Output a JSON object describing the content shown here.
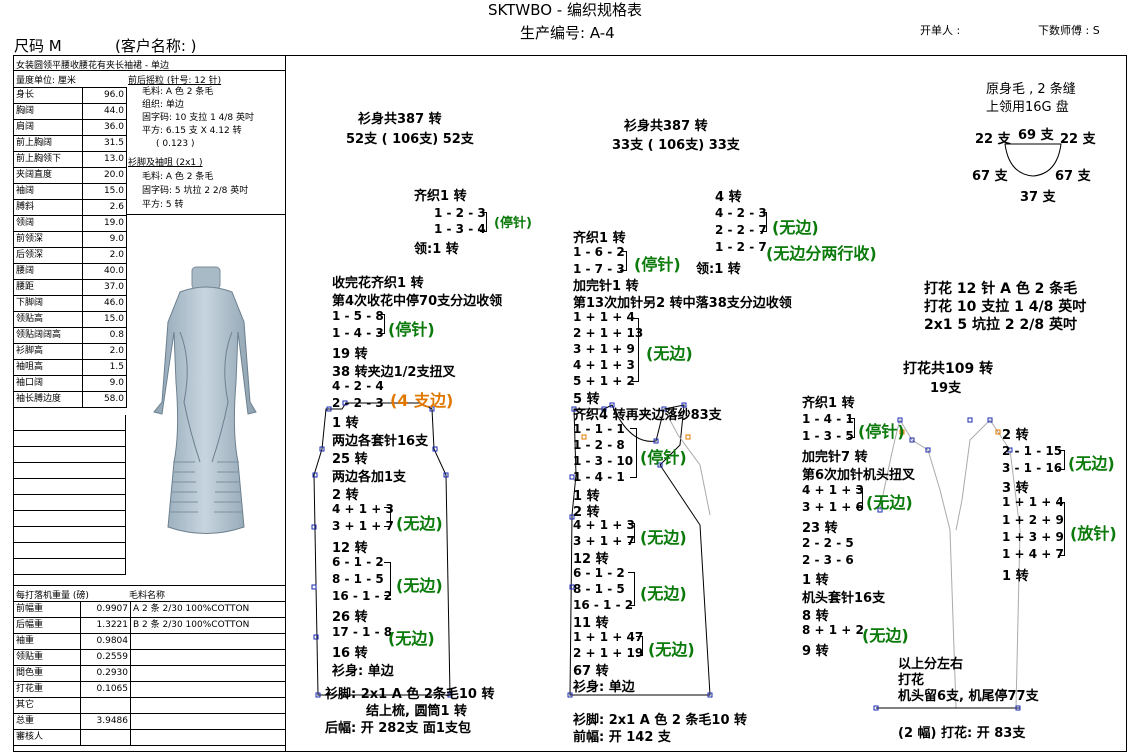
{
  "header": {
    "title": "SKTWBO - 编织规格表",
    "prod_no": "生产编号: A-4",
    "opener": "开单人 :",
    "master": "下数师傅 : S",
    "size": "尺码  M",
    "customer": "(客户名称: )"
  },
  "spec": {
    "caption": "女装圆领平腰收腰花有夹长袖裙 - 单边",
    "unit": "量度单位: 厘米",
    "rows": [
      [
        "身长",
        "96.0"
      ],
      [
        "胸阔",
        "44.0"
      ],
      [
        "肩阔",
        "36.0"
      ],
      [
        "前上胸阔",
        "31.5"
      ],
      [
        "前上胸领下",
        "13.0"
      ],
      [
        "夹阔直度",
        "20.0"
      ],
      [
        "袖阔",
        "15.0"
      ],
      [
        "膊斜",
        "2.6"
      ],
      [
        "领阔",
        "19.0"
      ],
      [
        "前领深",
        "9.0"
      ],
      [
        "后领深",
        "2.0"
      ],
      [
        "腰阔",
        "40.0"
      ],
      [
        "腰距",
        "37.0"
      ],
      [
        "下脚阔",
        "46.0"
      ],
      [
        "领贴高",
        "15.0"
      ],
      [
        "领贴阔阔高",
        "0.8"
      ],
      [
        "衫脚高",
        "2.0"
      ],
      [
        "袖咀高",
        "1.5"
      ],
      [
        "袖口阔",
        "9.0"
      ],
      [
        "袖长膊边度",
        "58.0"
      ]
    ],
    "body_head": "前后摇粒 (针号: 12 针)",
    "body_lines": [
      "毛料: A 色 2 条毛",
      "组织: 单边",
      "固字码: 10 支拉 1 4/8 英吋",
      "平方: 6.15 支 X  4.12 转",
      "( 0.123 )"
    ],
    "rib_head": "衫脚及袖咀 (2x1 )",
    "rib_lines": [
      "毛料: A 色 2 条毛",
      "固字码: 5 坑拉 2 2/8 英吋",
      "平方: 5 转"
    ],
    "weight_head": "每打落机重量 (磅)",
    "yarn_head": "毛料名称",
    "weights": [
      [
        "前幅重",
        "0.9907",
        "A  2 条 2/30 100%COTTON"
      ],
      [
        "后幅重",
        "1.3221",
        "B  2 条 2/30 100%COTTON"
      ],
      [
        "袖重",
        "0.9804",
        ""
      ],
      [
        "领贴重",
        "0.2559",
        ""
      ],
      [
        "間色重",
        "0.2930",
        ""
      ],
      [
        "打花重",
        "0.1065",
        ""
      ],
      [
        "其它",
        "",
        ""
      ],
      [
        "总重",
        "3.9486",
        ""
      ],
      [
        "審核人",
        "",
        ""
      ]
    ]
  },
  "back": {
    "total": "衫身共387 转",
    "split": "52支 ( 106支) 52支",
    "collar1": "齐织1 转",
    "c_a": "1 - 2 - 3",
    "c_b": "1 - 3 - 4",
    "stop": "(停针)",
    "collar2": "领:1 转",
    "l1": "收完花齐织1 转",
    "l2": "第4次收花中停70支分边收领",
    "r1": "1 - 5 - 8",
    "r2": "1 - 4 - 3",
    "l3": "19 转",
    "l4": "38 转夹边1/2支扭叉",
    "r3": "4 - 2 - 4",
    "r4": "2 - 2 - 3",
    "four": "(4 支边)",
    "l5": "1 转",
    "l6": "两边各套针16支",
    "l7": "25 转",
    "l8": "两边各加1支",
    "l9": "2 转",
    "r5": "4 + 1 + 3",
    "r6": "3 + 1 + 7",
    "noedge": "(无边)",
    "l10": "12 转",
    "r7": "6 - 1 - 2",
    "r8": "8 - 1 - 5",
    "r9": "16 - 1 - 2",
    "l11": "26 转",
    "r10": "17 - 1 - 8",
    "l12": "16 转",
    "l13": "衫身: 单边",
    "hem": "衫脚: 2x1     A 色  2条毛10 转",
    "hem2": "结上梳, 圆筒1 转",
    "start": "后幅: 开 282支 面1支包"
  },
  "front": {
    "total": "衫身共387 转",
    "split": "33支 ( 106支) 33支",
    "a1": "4 转",
    "a2": "4 - 2 - 3",
    "a3": "2 - 2 - 7",
    "a4": "1 - 2 - 7",
    "noedge": "(无边)",
    "noedge2": "(无边分两行收)",
    "b1": "齐织1 转",
    "b2": "1 - 6 - 2",
    "b3": "1 - 7 - 3",
    "stop": "(停针)",
    "collar": "领:1 转",
    "c1": "加完针1 转",
    "c2": "第13次加针另2 转中落38支分边收领",
    "c3": "1 + 1 + 4",
    "c4": "2 + 1 + 13",
    "c5": "3 + 1 + 9",
    "c6": "4 + 1 + 3",
    "c7": "5 + 1 + 2",
    "c8": "5 转",
    "c9": "齐织4 转再夹边落纱83支",
    "d1": "1 - 1 - 1",
    "d2": "1 - 2 - 8",
    "d3": "1 - 3 - 10",
    "d4": "1 - 4 - 1",
    "d5": "1 转",
    "d6": "2 转",
    "d7": "4 + 1 + 3",
    "d8": "3 + 1 + 7",
    "d9": "12 转",
    "d10": "6 - 1 - 2",
    "d11": "8 - 1 - 5",
    "d12": "16 - 1 - 2",
    "d13": "11 转",
    "d14": "1 + 1 + 47",
    "d15": "2 + 1 + 19",
    "d16": "67 转",
    "d17": "衫身: 单边",
    "hem": "衫脚: 2x1     A 色 2 条毛10 转",
    "start": "前幅: 开 142 支"
  },
  "collar_box": {
    "l1": "原身毛 , 2 条缝",
    "l2": "上领用16G 盘",
    "t1": "22 支",
    "t2": "69 支",
    "t3": "22 支",
    "m1": "67 支",
    "m2": "67 支",
    "b1": "37 支"
  },
  "pattern": {
    "p1": "打花  12 针 A 色  2 条毛",
    "p2": "打花  10 支拉 1 4/8 英吋",
    "p3": "2x1    5 坑拉 2 2/8 英吋",
    "tot": "打花共109 转",
    "n": "19支",
    "e1": "齐织1 转",
    "e2": "1 - 4 - 1",
    "e3": "1 - 3 - 5",
    "stop": "(停针)",
    "e4": "加完针7 转",
    "e5": "第6次加针机头扭叉",
    "e6": "4 + 1 + 3",
    "e7": "3 + 1 + 6",
    "noedge": "(无边)",
    "e8": "23 转",
    "e9": "2 - 2 - 5",
    "e10": "2 - 3 - 6",
    "e11": "1 转",
    "e12": "机头套针16支",
    "e13": "8 转",
    "e14": "8 + 1 + 2",
    "e15": "9 转",
    "f1": "2 转",
    "f2": "2 - 1 - 15",
    "f3": "3 - 1 - 16",
    "f4": "3 转",
    "f5": "1 + 1 + 4",
    "f6": "1 + 2 + 9",
    "f7": "1 + 3 + 9",
    "f8": "1 + 4 + 7",
    "f9": "1 转",
    "release": "(放针)",
    "g1": "以上分左右",
    "g2": "打花",
    "g3": "机头留6支, 机尾停77支",
    "start": "(2 幅) 打花: 开 83支"
  }
}
